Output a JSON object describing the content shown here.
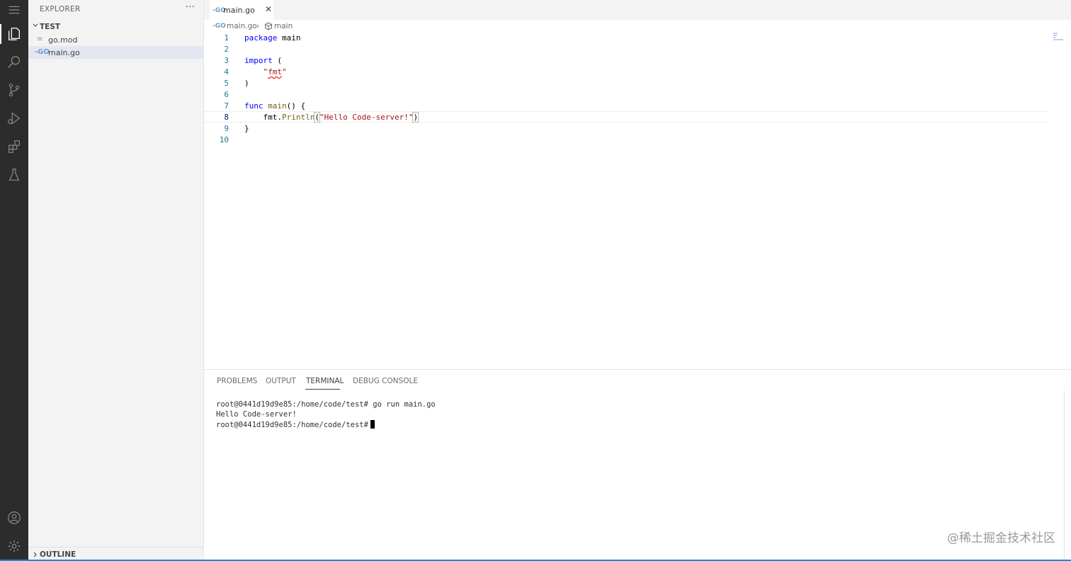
{
  "colors": {
    "activity_bar": "#2c2c2c",
    "sidebar_bg": "#f3f3f3",
    "selected_row": "#e4e6f1",
    "keyword": "#0000ff",
    "string": "#a31515",
    "line_number": "#237893"
  },
  "activity_bar": {
    "items": [
      {
        "icon": "menu-icon"
      },
      {
        "icon": "files-icon"
      },
      {
        "icon": "search-icon"
      },
      {
        "icon": "source-control-icon"
      },
      {
        "icon": "run-debug-icon"
      },
      {
        "icon": "extensions-icon"
      },
      {
        "icon": "testing-flask-icon"
      },
      {
        "icon": "account-icon"
      },
      {
        "icon": "gear-icon"
      }
    ]
  },
  "sidebar": {
    "title": "EXPLORER",
    "more": "···",
    "folder": "TEST",
    "files": [
      {
        "name": "go.mod",
        "icon": "gomod-file-icon"
      },
      {
        "name": "main.go",
        "icon": "go-file-icon",
        "selected": true
      }
    ],
    "outline": "OUTLINE"
  },
  "tabs": [
    {
      "label": "main.go",
      "close": "✕",
      "icon_text": "-GO"
    }
  ],
  "breadcrumb": {
    "file": "main.go",
    "separator": "›",
    "symbol": "main"
  },
  "editor": {
    "line_numbers": [
      "1",
      "2",
      "3",
      "4",
      "5",
      "6",
      "7",
      "8",
      "9",
      "10"
    ],
    "current_line": 8,
    "tokens": {
      "l1_kw": "package",
      "l1_rest": " main",
      "l3_kw": "import",
      "l3_rest": " (",
      "l4_indent": "    ",
      "l4_q1": "\"",
      "l4_str": "fmt",
      "l4_q2": "\"",
      "l5": ")",
      "l7_kw": "func",
      "l7_fn": "main",
      "l7_rest": "() {",
      "l8_indent": "    ",
      "l8_pkg": "fmt",
      "l8_dot": ".",
      "l8_fn": "Println",
      "l8_open": "(",
      "l8_str": "\"Hello Code-server!\"",
      "l8_close": ")",
      "l9": "}"
    }
  },
  "panel": {
    "tabs": [
      "PROBLEMS",
      "OUTPUT",
      "TERMINAL",
      "DEBUG CONSOLE"
    ],
    "active_tab": "TERMINAL",
    "terminal_lines": [
      "root@0441d19d9e85:/home/code/test# go run main.go",
      "Hello Code-server!",
      "root@0441d19d9e85:/home/code/test#"
    ]
  },
  "watermark": "@稀土掘金技术社区"
}
